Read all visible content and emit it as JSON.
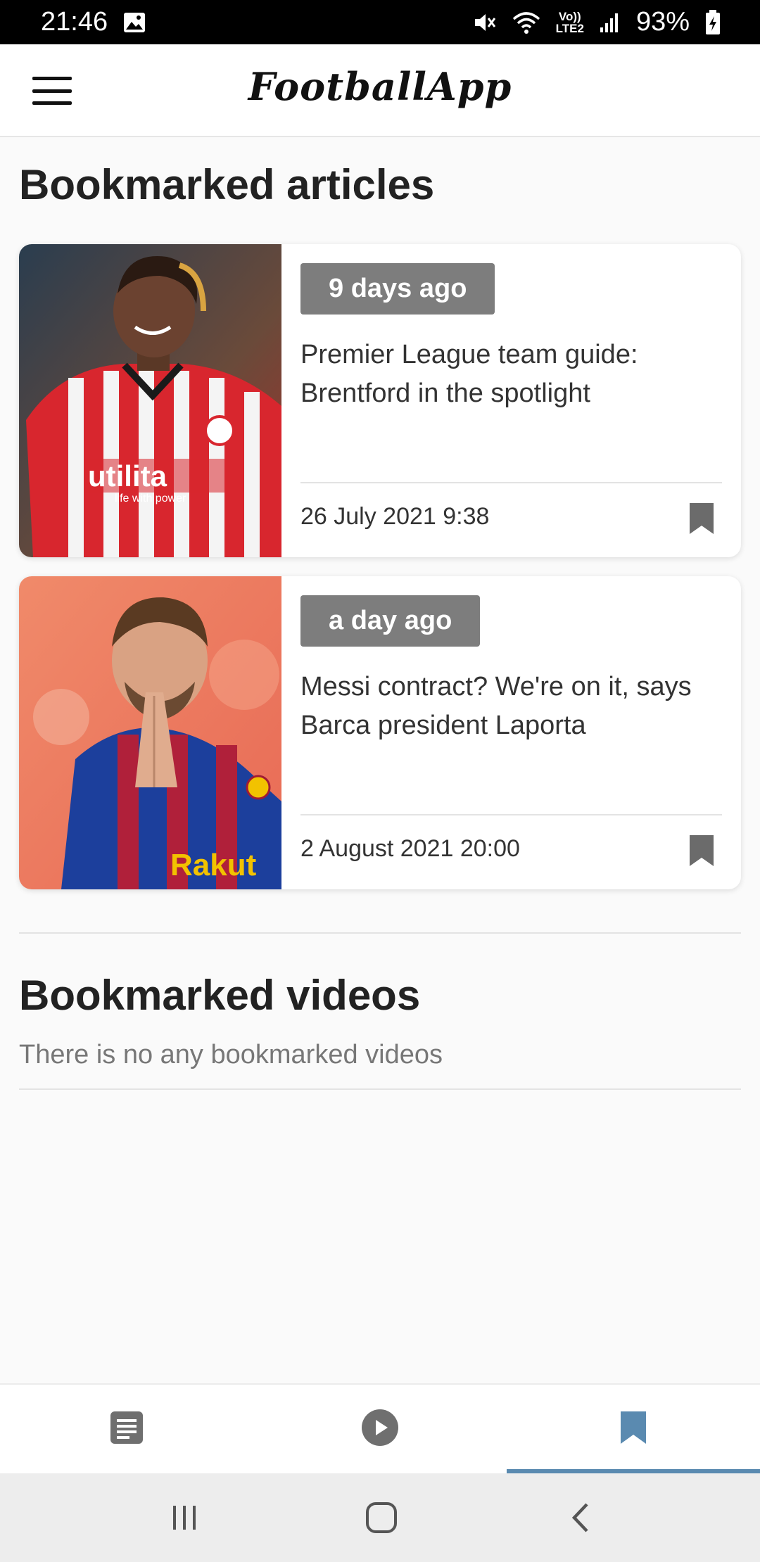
{
  "status_bar": {
    "time": "21:46",
    "network_top": "Vo))",
    "network_bottom": "LTE2",
    "battery": "93%"
  },
  "app_bar": {
    "title": "FootballApp",
    "menu_icon": "hamburger-menu-icon"
  },
  "articles_section": {
    "title": "Bookmarked articles",
    "items": [
      {
        "time_ago": "9 days ago",
        "title": "Premier League team guide: Brentford in the spotlight",
        "date": "26 July 2021 9:38",
        "thumb_shirt": "utilita",
        "thumb_shirt_sub": "life with power",
        "bookmarked": true
      },
      {
        "time_ago": "a day ago",
        "title": "Messi contract? We're on it, says Barca president Laporta",
        "date": "2 August 2021 20:00",
        "thumb_shirt": "Rakut",
        "thumb_shirt_sub": "",
        "bookmarked": true
      }
    ]
  },
  "videos_section": {
    "title": "Bookmarked videos",
    "empty_text": "There is no any bookmarked videos"
  },
  "bottom_nav": {
    "tabs": [
      {
        "icon": "article-icon",
        "active": false
      },
      {
        "icon": "play-icon",
        "active": false
      },
      {
        "icon": "bookmark-icon",
        "active": true
      }
    ],
    "active_color": "#5a8ab0",
    "inactive_color": "#6f6f6f"
  },
  "colors": {
    "badge": "#7d7d7d",
    "background": "#fafafa"
  }
}
